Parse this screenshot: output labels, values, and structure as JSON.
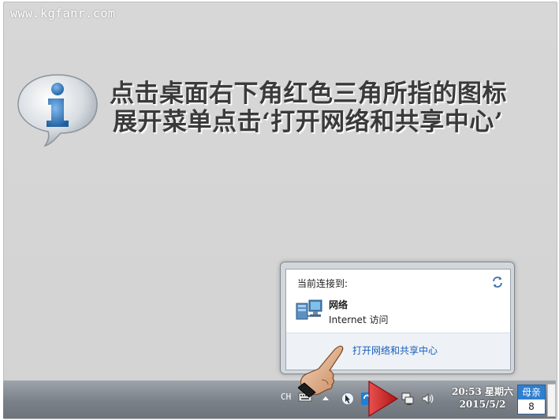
{
  "watermark": "www.kgfanr.com",
  "instruction": {
    "line1": "点击桌面右下角红色三角所指的图标",
    "line2": "展开菜单点击‘打开网络和共享中心’"
  },
  "network_popup": {
    "title": "当前连接到:",
    "network_name": "网络",
    "network_status": "Internet 访问",
    "open_center_link": "打开网络和共享中心"
  },
  "taskbar": {
    "language": "CH",
    "time": "20:53 星期六",
    "date": "2015/5/2",
    "calendar_label": "母亲",
    "calendar_day": "8"
  },
  "colors": {
    "pointer_arrow": "#d42a2a",
    "link": "#1a5cb8",
    "info_icon": "#2a6fb5"
  },
  "icons": [
    "info-icon",
    "refresh-icon",
    "network-icon",
    "keyboard-icon",
    "show-hidden-icons-icon",
    "action-center-icon",
    "sync-icon",
    "network-tray-icon",
    "volume-icon",
    "pointing-hand-icon",
    "red-pointer-arrow-icon"
  ]
}
